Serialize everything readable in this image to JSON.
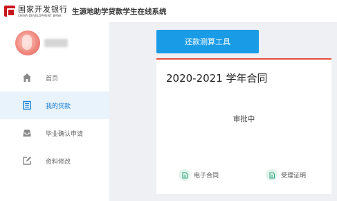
{
  "header": {
    "bank_name_cn": "国家开发银行",
    "bank_name_en": "CHINA DEVELOPMENT BANK",
    "system_title": "生源地助学贷款学生在线系统"
  },
  "sidebar": {
    "items": [
      {
        "label": "首页",
        "icon": "home-icon",
        "active": false
      },
      {
        "label": "我的贷款",
        "icon": "document-list-icon",
        "active": true
      },
      {
        "label": "毕业确认申请",
        "icon": "inbox-icon",
        "active": false
      },
      {
        "label": "资料修改",
        "icon": "edit-icon",
        "active": false
      }
    ]
  },
  "main": {
    "calc_button_label": "还款测算工具",
    "contract": {
      "title": "2020-2021 学年合同",
      "status": "审批中",
      "links": [
        {
          "label": "电子合同",
          "icon": "document-icon"
        },
        {
          "label": "受理证明",
          "icon": "document-icon"
        }
      ]
    }
  },
  "colors": {
    "accent_blue": "#1a9be6",
    "active_nav_bg": "#e8f3fc",
    "active_nav_text": "#1a7fd4",
    "card_top_border": "#e74c3c",
    "brand_red": "#c8161d",
    "icon_green": "#2fa67a"
  }
}
